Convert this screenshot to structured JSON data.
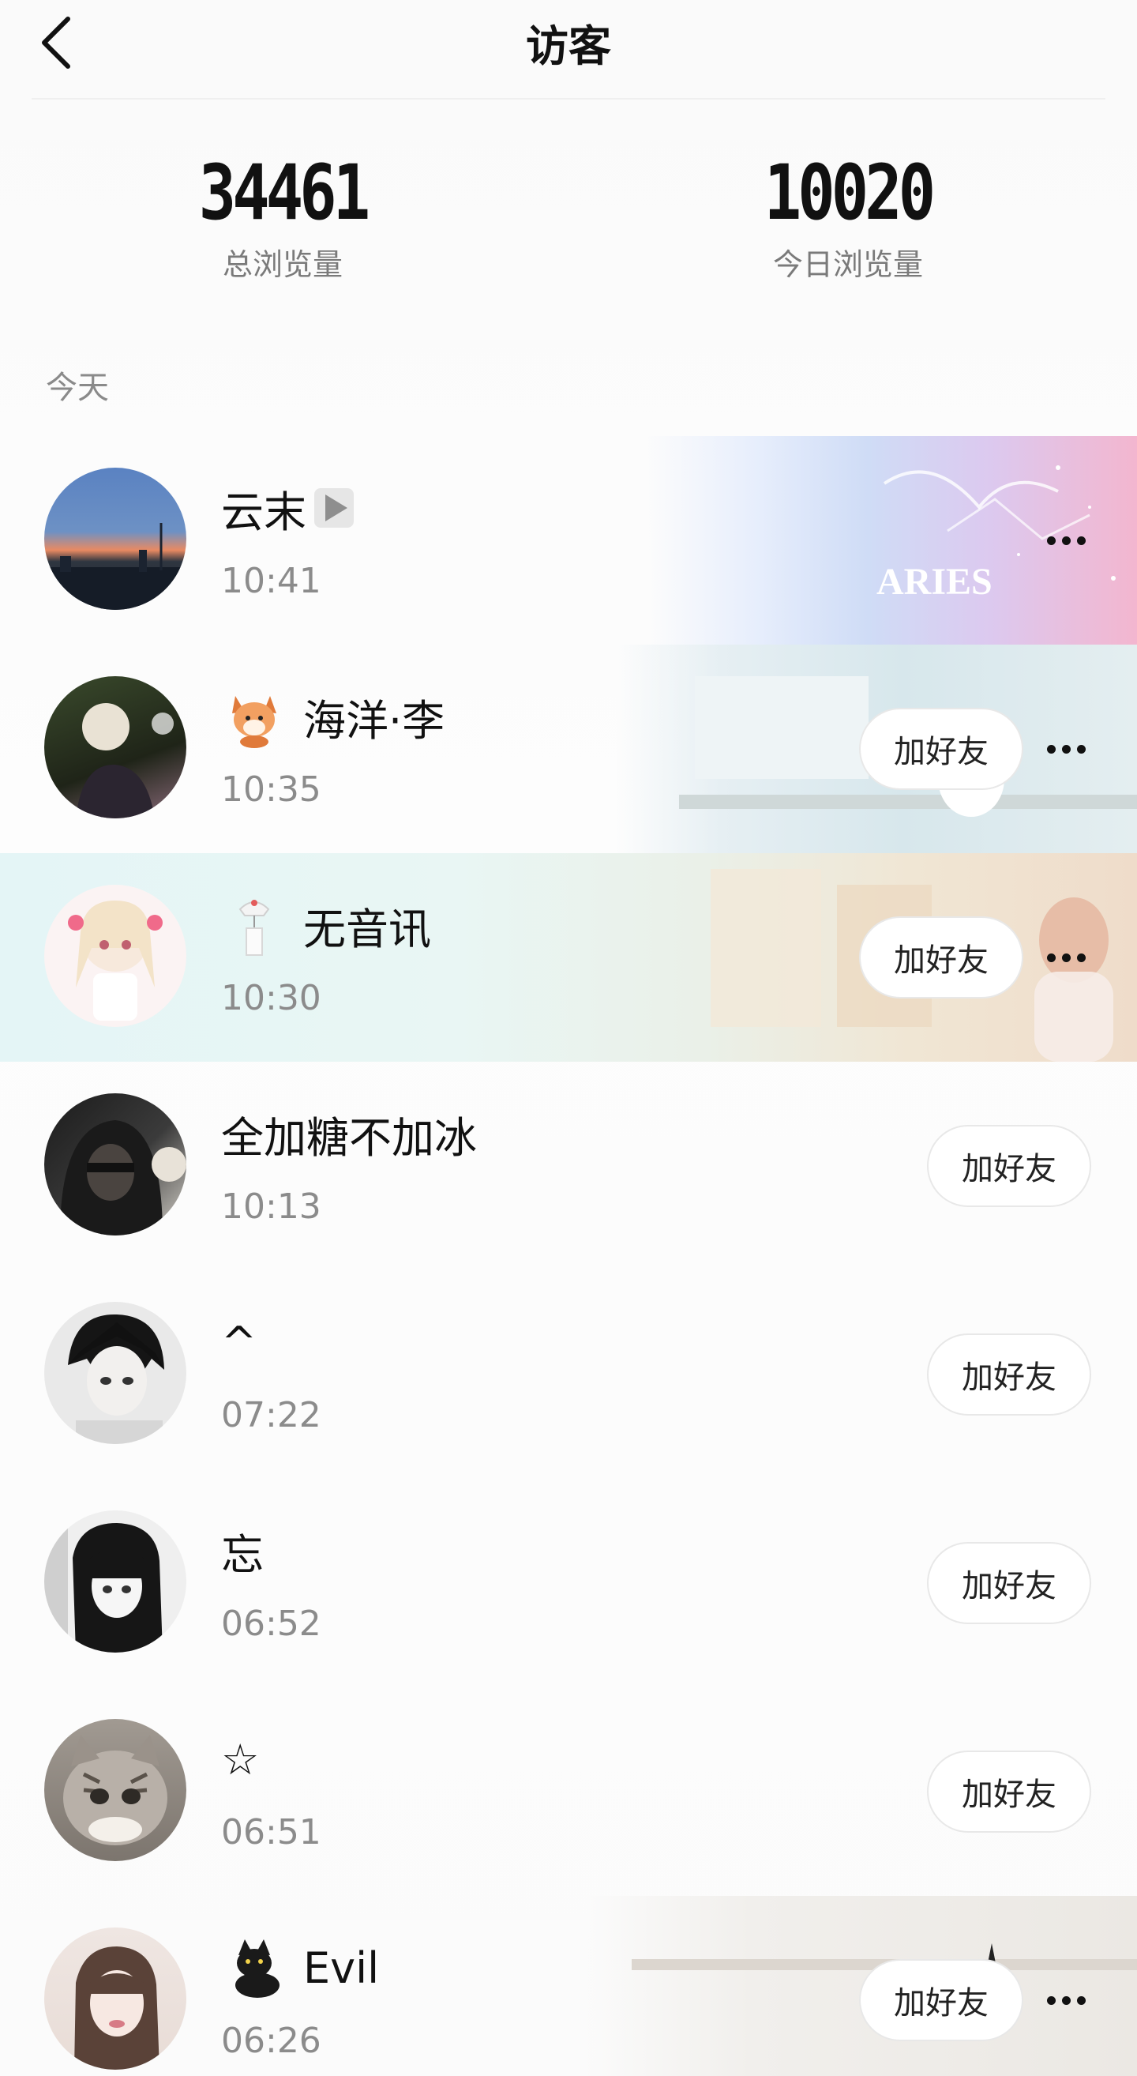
{
  "header": {
    "title": "访客",
    "back_icon": "chevron-left-icon"
  },
  "stats": {
    "total": {
      "value": "34461",
      "label": "总浏览量"
    },
    "today": {
      "value": "10020",
      "label": "今日浏览量"
    }
  },
  "section_label": "今天",
  "visitors": [
    {
      "name": "云末",
      "time": "10:41",
      "badge": "play-icon",
      "theme_text": "ARIES",
      "more_icon": "more-icon"
    },
    {
      "name": "海洋·李",
      "time": "10:35",
      "badge": "fox-icon",
      "add_label": "加好友",
      "more_icon": "more-icon"
    },
    {
      "name": "无音讯",
      "time": "10:30",
      "badge": "wind-chime-icon",
      "add_label": "加好友",
      "more_icon": "more-icon"
    },
    {
      "name": "全加糖不加冰",
      "time": "10:13",
      "add_label": "加好友"
    },
    {
      "name": "^",
      "time": "07:22",
      "add_label": "加好友"
    },
    {
      "name": "忘",
      "time": "06:52",
      "add_label": "加好友"
    },
    {
      "name": "☆",
      "time": "06:51",
      "add_label": "加好友"
    },
    {
      "name": "Evil",
      "time": "06:26",
      "badge": "black-cat-icon",
      "add_label": "加好友",
      "more_icon": "more-icon"
    }
  ]
}
